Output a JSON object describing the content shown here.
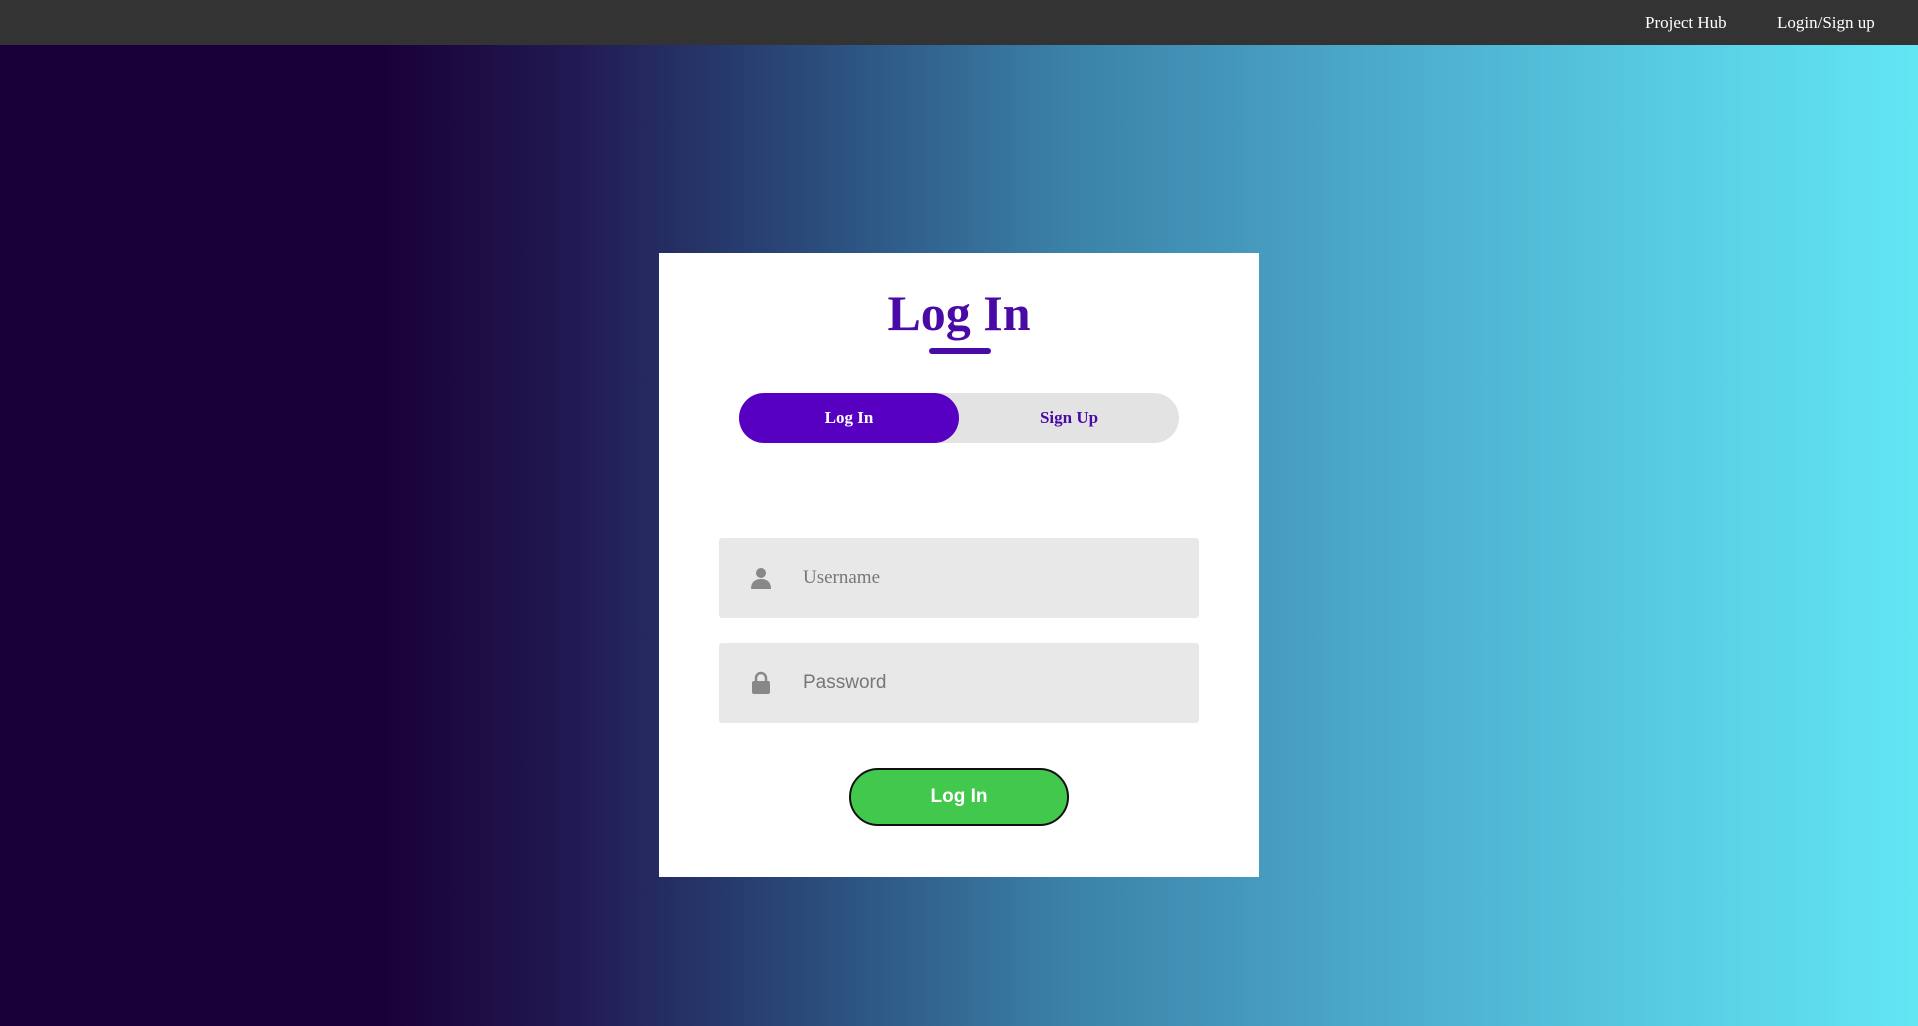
{
  "navbar": {
    "links": [
      {
        "label": "Project Hub"
      },
      {
        "label": "Login/Sign up"
      }
    ]
  },
  "form": {
    "title": "Log In",
    "toggle": {
      "login_label": "Log In",
      "signup_label": "Sign Up",
      "active": "Log In"
    },
    "username": {
      "placeholder": "Username",
      "value": "",
      "icon": "user-icon"
    },
    "password": {
      "placeholder": "Password",
      "value": "",
      "icon": "lock-icon"
    },
    "submit_label": "Log In"
  },
  "colors": {
    "accent_purple": "#5700c2",
    "title_purple": "#4a0aa6",
    "submit_green": "#42c94d",
    "navbar_bg": "#333333"
  }
}
